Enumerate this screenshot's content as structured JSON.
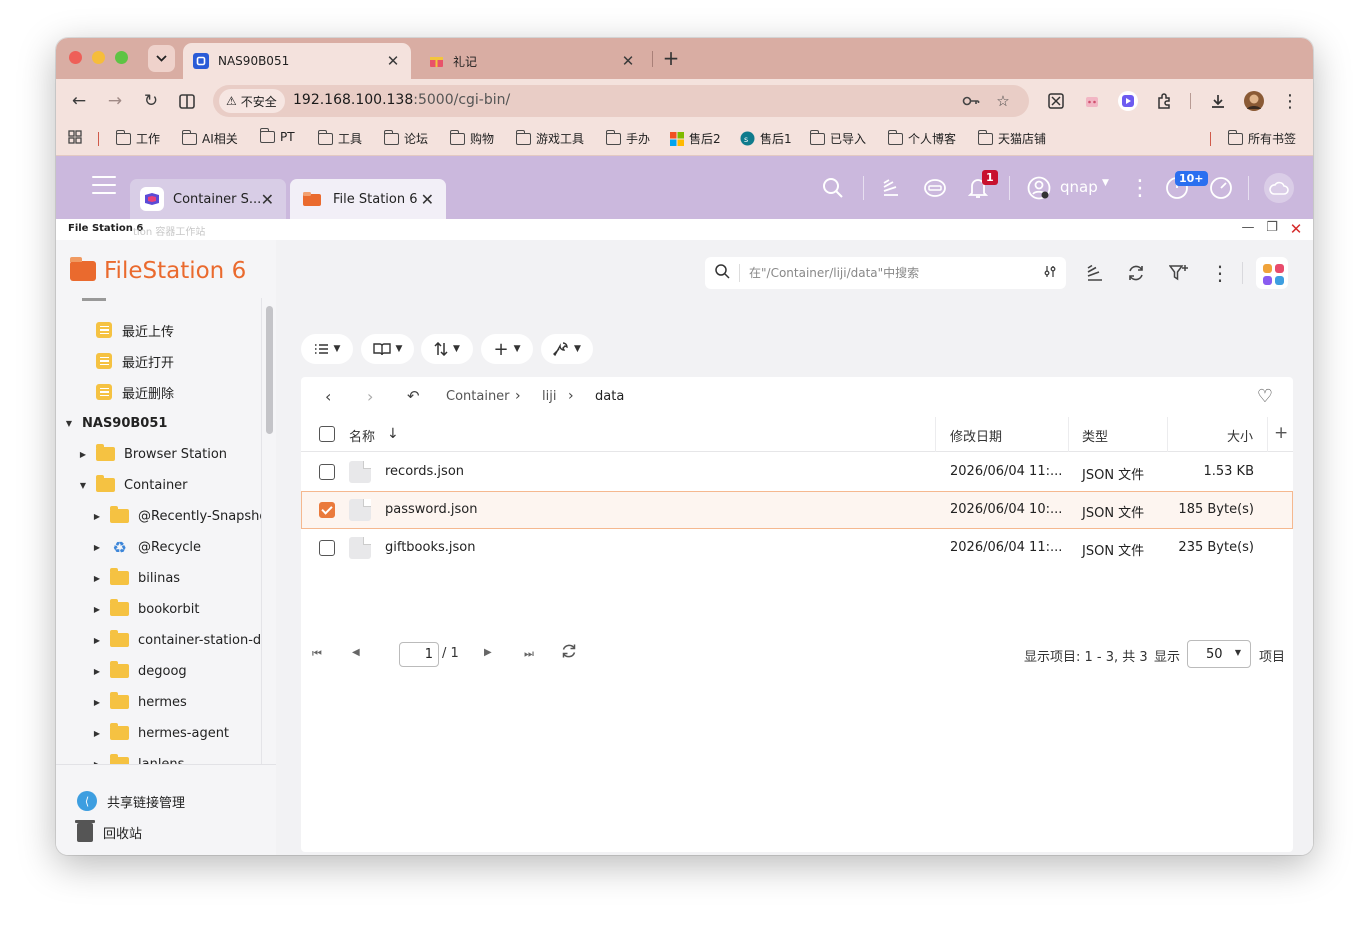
{
  "browser": {
    "tabs": [
      {
        "title": "NAS90B051",
        "active": true
      },
      {
        "title": "礼记",
        "active": false
      }
    ],
    "url_host": "192.168.100.138",
    "url_rest": ":5000/cgi-bin/",
    "security_label": "不安全",
    "bookmarks": [
      "工作",
      "AI相关",
      "PT",
      "工具",
      "论坛",
      "购物",
      "游戏工具",
      "手办",
      "售后2",
      "售后1",
      "已导入",
      "个人博客",
      "天猫店铺"
    ],
    "all_bookmarks": "所有书签"
  },
  "qnap": {
    "apptabs": [
      {
        "label": "Container S..."
      },
      {
        "label": "File Station 6"
      }
    ],
    "notification_count": "1",
    "tasks_badge": "10+",
    "user": "qnap"
  },
  "window": {
    "title": "File Station 6",
    "title_ghost": "tion 容器工作站"
  },
  "sidebar": {
    "app_name": "FileStation 6",
    "recent": [
      "最近上传",
      "最近打开",
      "最近删除"
    ],
    "nas_name": "NAS90B051",
    "nas_children": [
      "Browser Station",
      "Container"
    ],
    "container_children": [
      "@Recently-Snapshot",
      "@Recycle",
      "bilinas",
      "bookorbit",
      "container-station-data",
      "degoog",
      "hermes",
      "hermes-agent",
      "lanlens"
    ],
    "share_links": "共享链接管理",
    "recycle_bin": "回收站"
  },
  "search": {
    "placeholder": "在\"/Container/liji/data\"中搜索"
  },
  "breadcrumb": {
    "items": [
      "Container",
      "liji",
      "data"
    ]
  },
  "table": {
    "headers": {
      "name": "名称",
      "modified": "修改日期",
      "type": "类型",
      "size": "大小"
    },
    "rows": [
      {
        "name": "records.json",
        "modified": "2026/06/04 11:...",
        "type": "JSON 文件",
        "size": "1.53 KB",
        "selected": false
      },
      {
        "name": "password.json",
        "modified": "2026/06/04 10:...",
        "type": "JSON 文件",
        "size": "185 Byte(s)",
        "selected": true
      },
      {
        "name": "giftbooks.json",
        "modified": "2026/06/04 11:...",
        "type": "JSON 文件",
        "size": "235 Byte(s)",
        "selected": false
      }
    ]
  },
  "pager": {
    "page": "1",
    "total": "/ 1",
    "status": "显示项目: 1 - 3, 共 3",
    "show_label": "显示",
    "per_page": "50",
    "items_label": "项目"
  },
  "colors": {
    "accent": "#ea6a2e",
    "qnap_bar": "#cbb8dd",
    "chrome_tab": "#d9ada3"
  }
}
